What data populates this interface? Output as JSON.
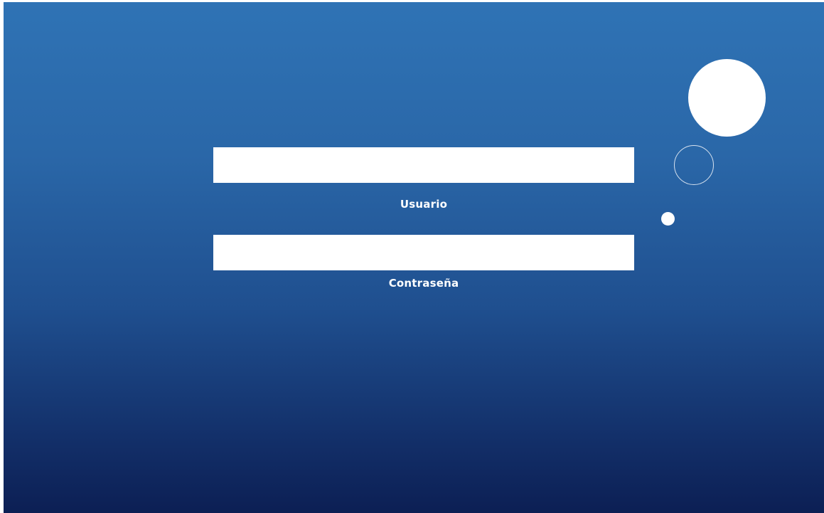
{
  "login": {
    "username_label": "Usuario",
    "password_label": "Contraseña",
    "username_value": "",
    "password_value": ""
  },
  "colors": {
    "gradient_top": "#2f73b5",
    "gradient_bottom": "#0c1f54",
    "field_background": "#ffffff",
    "label_text": "#ffffff"
  },
  "decor": {
    "icons": [
      "large-circle-icon",
      "ring-circle-icon",
      "small-dot-icon"
    ]
  }
}
